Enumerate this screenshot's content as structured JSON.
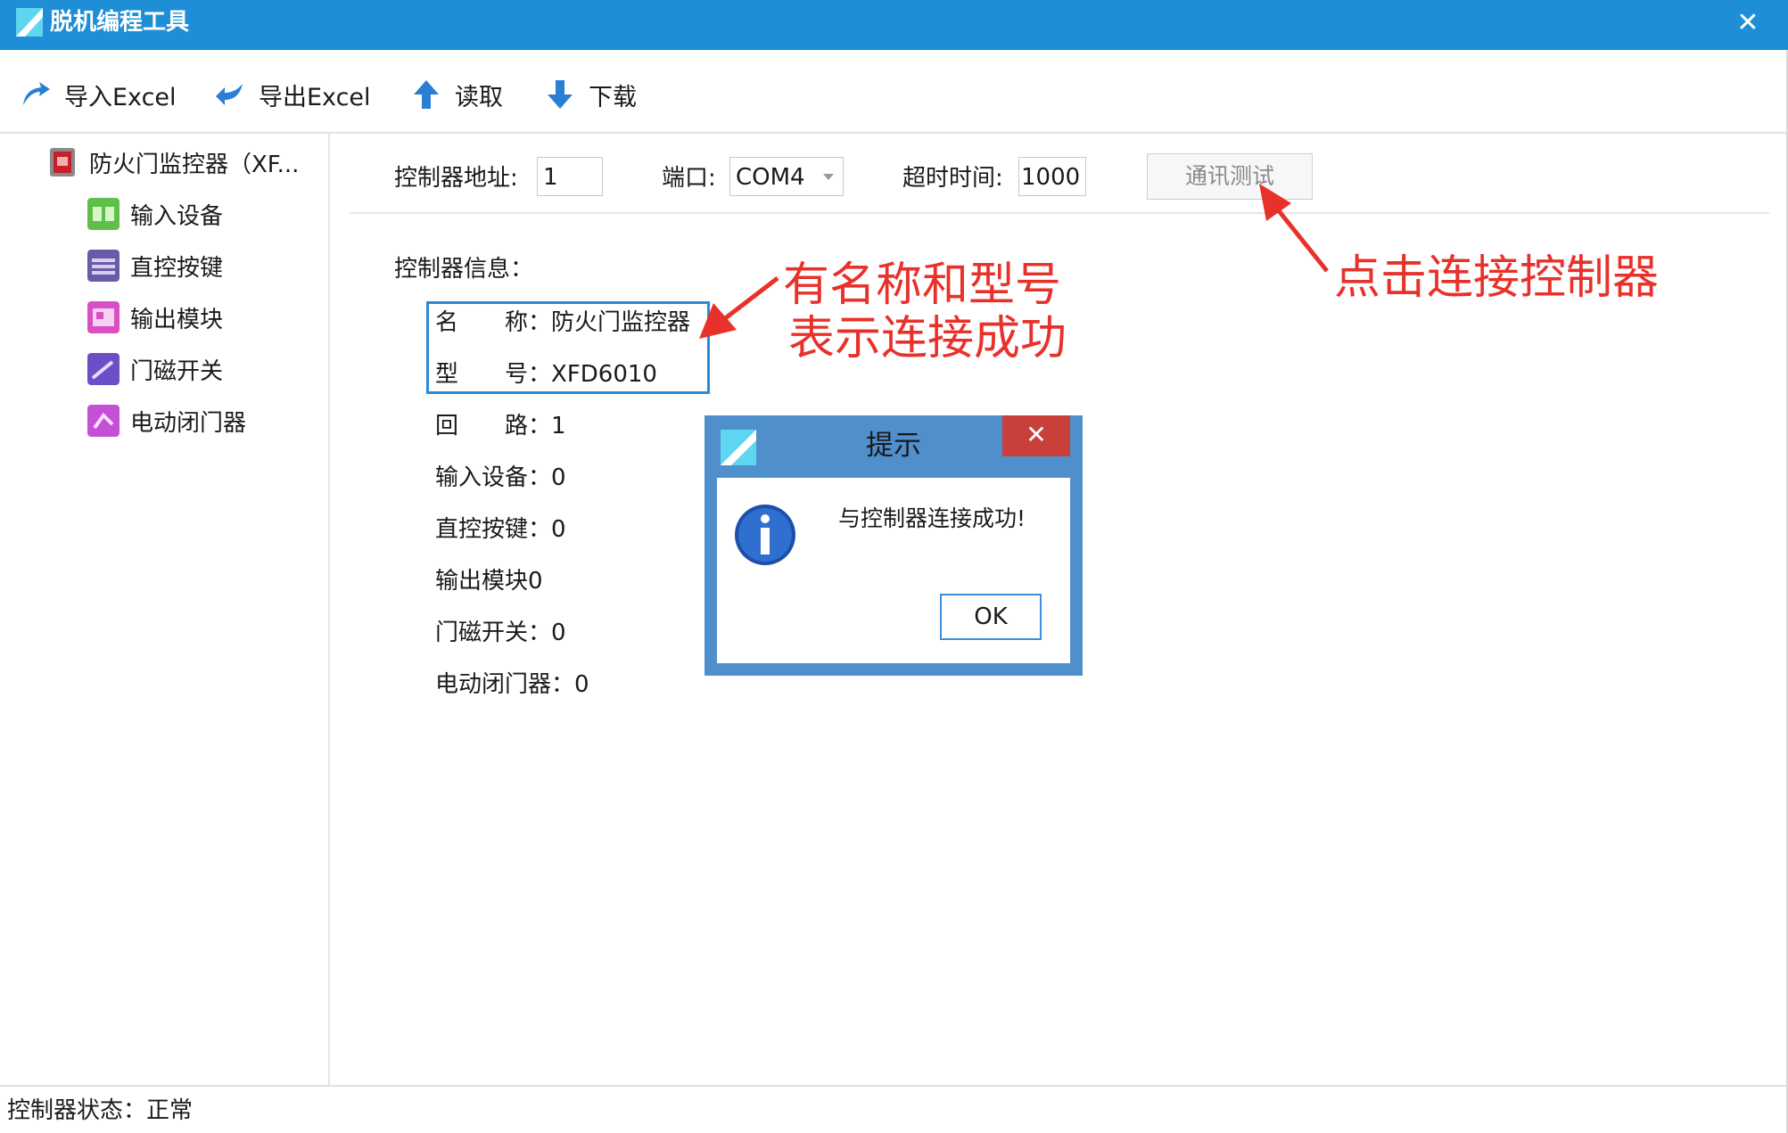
{
  "window": {
    "title": "脱机编程工具",
    "close_glyph": "✕"
  },
  "toolbar": {
    "items": [
      {
        "label": "导入Excel",
        "icon": "import-arrow-icon"
      },
      {
        "label": "导出Excel",
        "icon": "export-arrow-icon"
      },
      {
        "label": "读取",
        "icon": "upload-arrow-icon"
      },
      {
        "label": "下载",
        "icon": "download-arrow-icon"
      }
    ]
  },
  "sidebar": {
    "root": {
      "label": "防火门监控器（XF...",
      "icon": "controller-icon"
    },
    "items": [
      {
        "label": "输入设备",
        "icon": "input-device-icon"
      },
      {
        "label": "直控按键",
        "icon": "keyboard-icon"
      },
      {
        "label": "输出模块",
        "icon": "output-module-icon"
      },
      {
        "label": "门磁开关",
        "icon": "door-magnet-icon"
      },
      {
        "label": "电动闭门器",
        "icon": "door-closer-icon"
      }
    ]
  },
  "settings": {
    "address_label": "控制器地址:",
    "address_value": "1",
    "port_label": "端口:",
    "port_value": "COM4",
    "timeout_label": "超时时间:",
    "timeout_value": "1000",
    "test_button": "通讯测试"
  },
  "info": {
    "title": "控制器信息：",
    "name": {
      "key": "名　　称：",
      "value": "防火门监控器"
    },
    "model": {
      "key": "型　　号：",
      "value": "XFD6010"
    },
    "loop": {
      "key": "回　　路：",
      "value": "1"
    },
    "input_devices": "输入设备：0",
    "direct_keys": "直控按键：0",
    "output_modules": "输出模块0",
    "door_switches": "门磁开关：0",
    "door_closers": "电动闭门器：0"
  },
  "annotations": {
    "name_model": [
      "有名称和型号",
      "表示连接成功"
    ],
    "click_connect": "点击连接控制器",
    "color": "#e8312a"
  },
  "dialog": {
    "title": "提示",
    "close_glyph": "✕",
    "message": "与控制器连接成功!",
    "ok_label": "OK",
    "icon": "info-icon"
  },
  "status": {
    "text": "控制器状态：正常"
  },
  "colors": {
    "titlebar": "#1e8fd6",
    "dialog_frame": "#4f8fcc",
    "dialog_close": "#c9403a",
    "highlight": "#2a8bd8"
  }
}
